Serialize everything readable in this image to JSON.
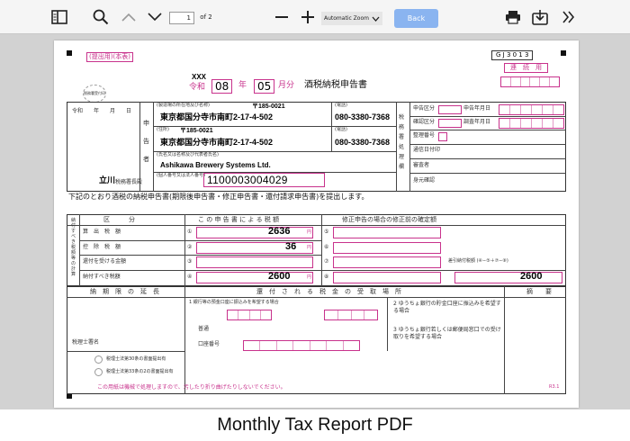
{
  "toolbar": {
    "page_current": "1",
    "page_total": "of 2",
    "zoom": "Automatic Zoom",
    "back": "Back"
  },
  "caption": "Monthly Tax Report PDF",
  "form": {
    "copy_label": "(提出用)(本表)",
    "form_code": "G J 3 0 1 3",
    "category": "連　続　用",
    "era_code": "XXX",
    "era": "令和",
    "year": "08",
    "year_unit": "年",
    "month": "05",
    "month_unit": "月分",
    "title": "酒税納税申告書",
    "receipt_stamp": "税務署受付印",
    "reiwa_date": "令和　　年　　月　　日",
    "side_applicant": "申告者",
    "address_label": "(製造場の所在地及び名称)",
    "postal1": "〒185-0021",
    "address1": "東京都国分寺市南町2-17-4-502",
    "tel_label": "(電話)",
    "phone1": "080-3380-7368",
    "residence_label": "(住所)",
    "postal2": "〒185-0021",
    "address2": "東京都国分寺市南町2-17-4-502",
    "phone2": "080-3380-7368",
    "name_label": "(氏名又は名称及び代表者氏名)",
    "company": "Ashikawa Brewery Systems Ltd.",
    "number_label": "(個人番号又は法人番号)",
    "corp_number": "1100003004029",
    "office": "立川",
    "office_suffix": "税務署長殿",
    "right_labels": [
      "申告区分",
      "確認区分",
      "整理番号",
      "通信日付印",
      "審査者",
      "身元確認"
    ],
    "right_date_labels": [
      "申告年月日",
      "調査年月日"
    ],
    "intro": "下記のとおり酒税の納税申告書(期限後申告書・修正申告書・還付請求申告書)を提出します。",
    "table_head": [
      "区　　　分",
      "こ の 申 告 書 に よ る 税 額",
      "修正申告の場合の修正前の確定額"
    ],
    "rows": [
      {
        "n": "①",
        "label": "算　出　税　額",
        "value": "2636"
      },
      {
        "n": "②",
        "label": "控　除　税　額",
        "value": "36"
      },
      {
        "n": "③",
        "label": "還付を受ける金額",
        "value": ""
      },
      {
        "n": "④",
        "label": "納付すべき税額",
        "value": "2600"
      }
    ],
    "right_nums": [
      "⑤",
      "⑥",
      "⑦",
      "⑧"
    ],
    "net_label": "差引納付税額 (④−⑤＋⑦−⑧)",
    "net_value": "2600",
    "yen": "円",
    "side_tax": "納付すべき税額等の計算",
    "extension": "納　期　限　の　延　長",
    "refund": "還　付　さ　れ　る　税　金　の　受　取　場　所",
    "remarks": "摘　　要",
    "bank_note": "1 銀行等の預金口座に振込みを希望する場合",
    "postal_note": "2 ゆうちょ銀行の貯金口座に振込みを希望する場合",
    "counter_note": "3 ゆうちょ銀行若しくは郵便局窓口での受け取りを希望する場合",
    "ordinary": "普通",
    "deposit_type": "口座種類",
    "deposit_number": "口座番号",
    "tax_acct": "税理士署名",
    "tax_acct_sign": "税理士法第30条の書面提出有",
    "tax_acct_sign2": "税理士法第33条の2の書面提出有",
    "footer_note": "この用紙は機械で処理しますので、汚したり折り曲げたりしないでください。",
    "form_rev": "R3.1"
  }
}
